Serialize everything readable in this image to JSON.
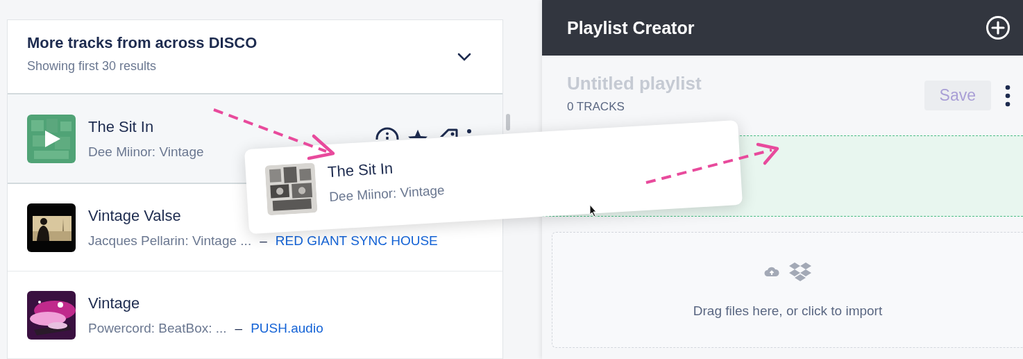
{
  "results": {
    "title": "More tracks from across DISCO",
    "subtitle": "Showing first 30 results"
  },
  "tracks": [
    {
      "title": "The Sit In",
      "subtitle": "Dee Miinor: Vintage",
      "selected": true
    },
    {
      "title": "Vintage Valse",
      "subtitle": "Jacques Pellarin: Vintage ...",
      "separator": "–",
      "label": "RED GIANT SYNC HOUSE",
      "selected": false
    },
    {
      "title": "Vintage",
      "subtitle": "Powercord: BeatBox: ...",
      "separator": "–",
      "label": "PUSH.audio",
      "selected": false
    }
  ],
  "drag_card": {
    "title": "The Sit In",
    "subtitle": "Dee Miinor: Vintage"
  },
  "playlist": {
    "header": "Playlist Creator",
    "name_placeholder": "Untitled playlist",
    "track_count": "0 TRACKS",
    "save": {
      "label": "Save",
      "disabled": true
    },
    "import_text": "Drag files here, or click to import"
  }
}
